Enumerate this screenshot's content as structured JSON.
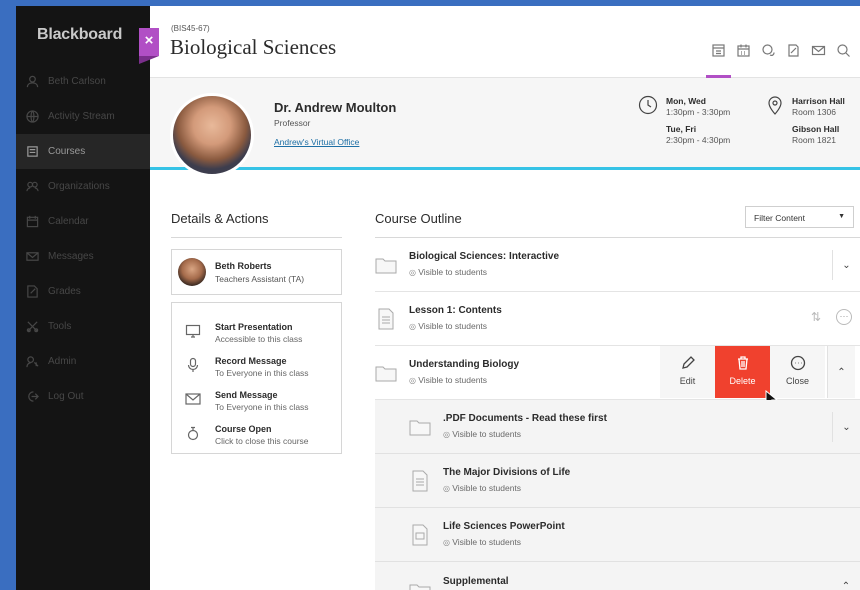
{
  "sidebar": {
    "brand": "Blackboard",
    "close_glyph": "×",
    "items": [
      {
        "label": "Beth Carlson",
        "icon": "user-icon"
      },
      {
        "label": "Activity Stream",
        "icon": "globe-icon"
      },
      {
        "label": "Courses",
        "icon": "courses-icon",
        "active": true
      },
      {
        "label": "Organizations",
        "icon": "organizations-icon"
      },
      {
        "label": "Calendar",
        "icon": "calendar-icon"
      },
      {
        "label": "Messages",
        "icon": "envelope-icon"
      },
      {
        "label": "Grades",
        "icon": "grades-icon"
      },
      {
        "label": "Tools",
        "icon": "tools-icon"
      },
      {
        "label": "Admin",
        "icon": "admin-icon"
      },
      {
        "label": "Log Out",
        "icon": "logout-icon"
      }
    ]
  },
  "header": {
    "course_id": "(BIS45-67)",
    "course_title": "Biological Sciences",
    "icons": [
      "content-icon",
      "calendar-icon",
      "discussions-icon",
      "gradebook-icon",
      "messages-icon",
      "search-icon"
    ]
  },
  "instructor": {
    "name": "Dr. Andrew Moulton",
    "role": "Professor",
    "link": "Andrew's Virtual Office",
    "schedule": [
      {
        "days": "Mon, Wed",
        "time": "1:30pm - 3:30pm",
        "location": "Harrison Hall",
        "room": "Room 1306"
      },
      {
        "days": "Tue, Fri",
        "time": "2:30pm - 4:30pm",
        "location": "Gibson Hall",
        "room": "Room 1821"
      }
    ]
  },
  "details": {
    "heading": "Details & Actions",
    "ta": {
      "name": "Beth Roberts",
      "role": "Teachers Assistant (TA)"
    },
    "actions": [
      {
        "title": "Start Presentation",
        "sub": "Accessible to this class",
        "icon": "presentation-icon"
      },
      {
        "title": "Record Message",
        "sub": "To Everyone in this class",
        "icon": "microphone-icon"
      },
      {
        "title": "Send Message",
        "sub": "To Everyone in this class",
        "icon": "envelope-icon"
      },
      {
        "title": "Course Open",
        "sub": "Click to close this course",
        "icon": "lock-open-icon"
      }
    ]
  },
  "outline": {
    "heading": "Course Outline",
    "filter": "Filter Content",
    "visibility": "Visible to students",
    "items": [
      {
        "title": "Biological Sciences: Interactive",
        "visibility": "Visible to students",
        "icon": "folder-icon"
      },
      {
        "title": "Lesson 1: Contents",
        "visibility": "Visible to students",
        "icon": "document-icon"
      },
      {
        "title": "Understanding Biology",
        "visibility": "Visible to students",
        "icon": "folder-icon"
      },
      {
        "title": ".PDF Documents - Read these first",
        "visibility": "Visible to students",
        "icon": "folder-icon"
      },
      {
        "title": "The Major Divisions of Life",
        "visibility": "Visible to students",
        "icon": "document-icon"
      },
      {
        "title": "Life Sciences PowerPoint",
        "visibility": "Visible to students",
        "icon": "presentation-file-icon"
      },
      {
        "title": "Supplemental",
        "icon": "folder-icon"
      }
    ],
    "row_actions": {
      "edit": "Edit",
      "delete": "Delete",
      "close": "Close"
    }
  }
}
